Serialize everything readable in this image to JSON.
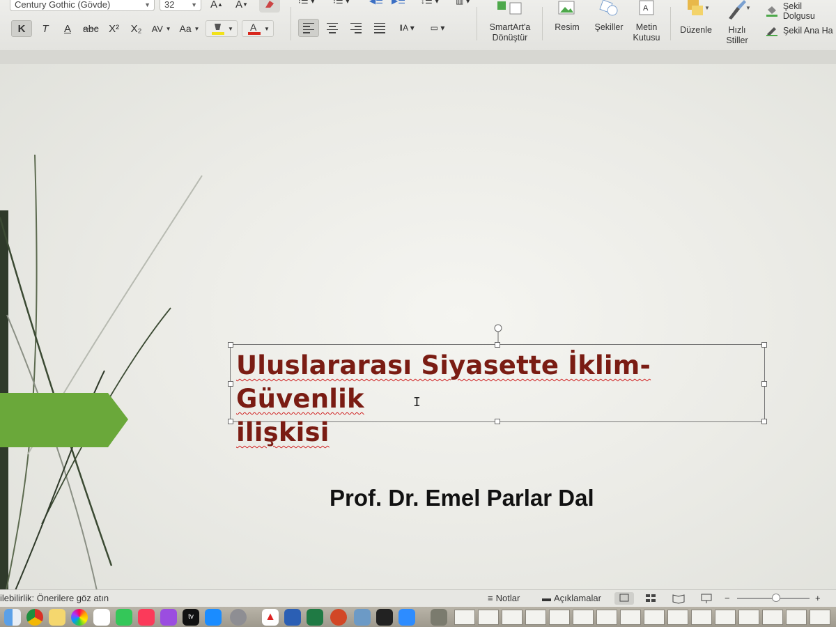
{
  "ribbon": {
    "font_name": "Century Gothic (Gövde)",
    "font_size": "32",
    "format_buttons": [
      "K",
      "T",
      "A",
      "abc",
      "X²",
      "X₂",
      "AV",
      "Aa"
    ],
    "smartart": {
      "line1": "SmartArt'a",
      "line2": "Dönüştür"
    },
    "resim": "Resim",
    "sekiller": "Şekiller",
    "metin": {
      "line1": "Metin",
      "line2": "Kutusu"
    },
    "duzenle": "Düzenle",
    "hizli": {
      "line1": "Hızlı",
      "line2": "Stiller"
    },
    "sekil_dolgusu": "Şekil Dolgusu",
    "sekil_ana_hat": "Şekil Ana Ha",
    "colors": {
      "highlight": "#f2e21a",
      "font_color": "#d8261c"
    }
  },
  "slide": {
    "title_line1": "Uluslararası Siyasette İklim-Güvenlik",
    "title_line2": "ilişkisi",
    "subtitle": "Prof. Dr. Emel Parlar Dal",
    "colors": {
      "title": "#7a1c13",
      "accent_green": "#6aa83a"
    }
  },
  "status": {
    "accessibility": "ilebilirlik: Önerilere göz atın",
    "notes": "Notlar",
    "comments": "Açıklamalar",
    "zoom_minus": "−",
    "zoom_plus": "+"
  },
  "dock": {
    "items": [
      "finder-icon",
      "chrome-icon",
      "notes-icon",
      "photos-icon",
      "reminders-icon",
      "facetime-icon",
      "music-icon",
      "podcasts-icon",
      "appletv-icon",
      "appstore-icon",
      "settings-icon",
      "acrobat-icon",
      "word-icon",
      "excel-icon",
      "powerpoint-icon",
      "preview-icon",
      "terminal-icon",
      "zoom-icon"
    ],
    "tv_label": "tv"
  }
}
